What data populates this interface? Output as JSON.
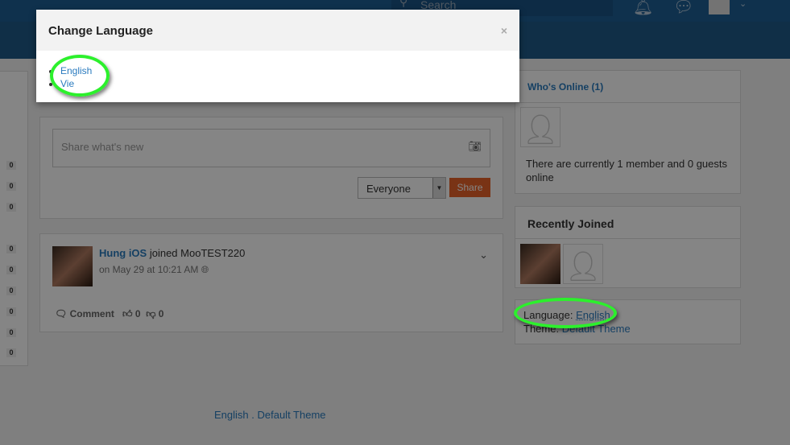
{
  "header": {
    "search_placeholder": "Search",
    "notifications_icon": "bell-icon",
    "messages_icon": "chat-icon"
  },
  "sidebar_counts": [
    "0",
    "0",
    "0",
    "0",
    "0",
    "0",
    "0",
    "0",
    "0"
  ],
  "composer": {
    "placeholder": "Share what's new",
    "privacy": "Everyone",
    "share_label": "Share"
  },
  "activity": {
    "user": "Hung iOS",
    "action": "joined MooTEST220",
    "time": "on May 29 at 10:21 AM",
    "comment_label": "Comment",
    "likes": "0",
    "dislikes": "0"
  },
  "whos_online": {
    "title": "Who's Online (1)",
    "text": "There are currently 1 member and 0 guests online"
  },
  "recently_joined": {
    "title": "Recently Joined"
  },
  "lang_box": {
    "language_label": "Language:",
    "language_value": "English",
    "theme_label": "Theme:",
    "theme_value": "Default Theme"
  },
  "footer": {
    "language": "English",
    "theme": ". Default Theme"
  },
  "modal": {
    "title": "Change Language",
    "close": "×",
    "options": [
      "English",
      "Vie"
    ]
  },
  "highlight_color": "#2cf02c"
}
